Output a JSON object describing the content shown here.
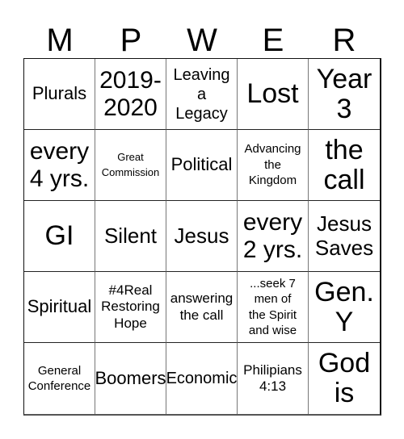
{
  "header": {
    "letters": [
      "M",
      "P",
      "W",
      "E",
      "R"
    ]
  },
  "board": {
    "rows": [
      [
        {
          "text": "Plurals",
          "size": "s-ms"
        },
        {
          "text": "2019-\n2020",
          "size": "s-l"
        },
        {
          "text": "Leaving\na\nLegacy",
          "size": "s-sm"
        },
        {
          "text": "Lost",
          "size": "s-xl"
        },
        {
          "text": "Year\n3",
          "size": "s-xl"
        }
      ],
      [
        {
          "text": "every\n4 yrs.",
          "size": "s-l"
        },
        {
          "text": "Great\nCommission",
          "size": "s-xxs"
        },
        {
          "text": "Political",
          "size": "s-ms"
        },
        {
          "text": "Advancing\nthe\nKingdom",
          "size": "s-xs"
        },
        {
          "text": "the\ncall",
          "size": "s-xl"
        }
      ],
      [
        {
          "text": "GI",
          "size": "s-xl"
        },
        {
          "text": "Silent",
          "size": "s-m"
        },
        {
          "text": "Jesus",
          "size": "s-m"
        },
        {
          "text": "every\n2 yrs.",
          "size": "s-l"
        },
        {
          "text": "Jesus\nSaves",
          "size": "s-m"
        }
      ],
      [
        {
          "text": "Spiritual",
          "size": "s-ms"
        },
        {
          "text": "#4Real\nRestoring\nHope",
          "size": "s-s"
        },
        {
          "text": "answering\nthe call",
          "size": "s-s"
        },
        {
          "text": "...seek 7\nmen of\nthe Spirit\nand wise",
          "size": "s-xs"
        },
        {
          "text": "Gen.\nY",
          "size": "s-xl"
        }
      ],
      [
        {
          "text": "General\nConference",
          "size": "s-xs"
        },
        {
          "text": "Boomers",
          "size": "s-ms"
        },
        {
          "text": "Economic",
          "size": "s-sm"
        },
        {
          "text": "Philipians\n4:13",
          "size": "s-s"
        },
        {
          "text": "God\nis",
          "size": "s-xl"
        }
      ]
    ]
  }
}
